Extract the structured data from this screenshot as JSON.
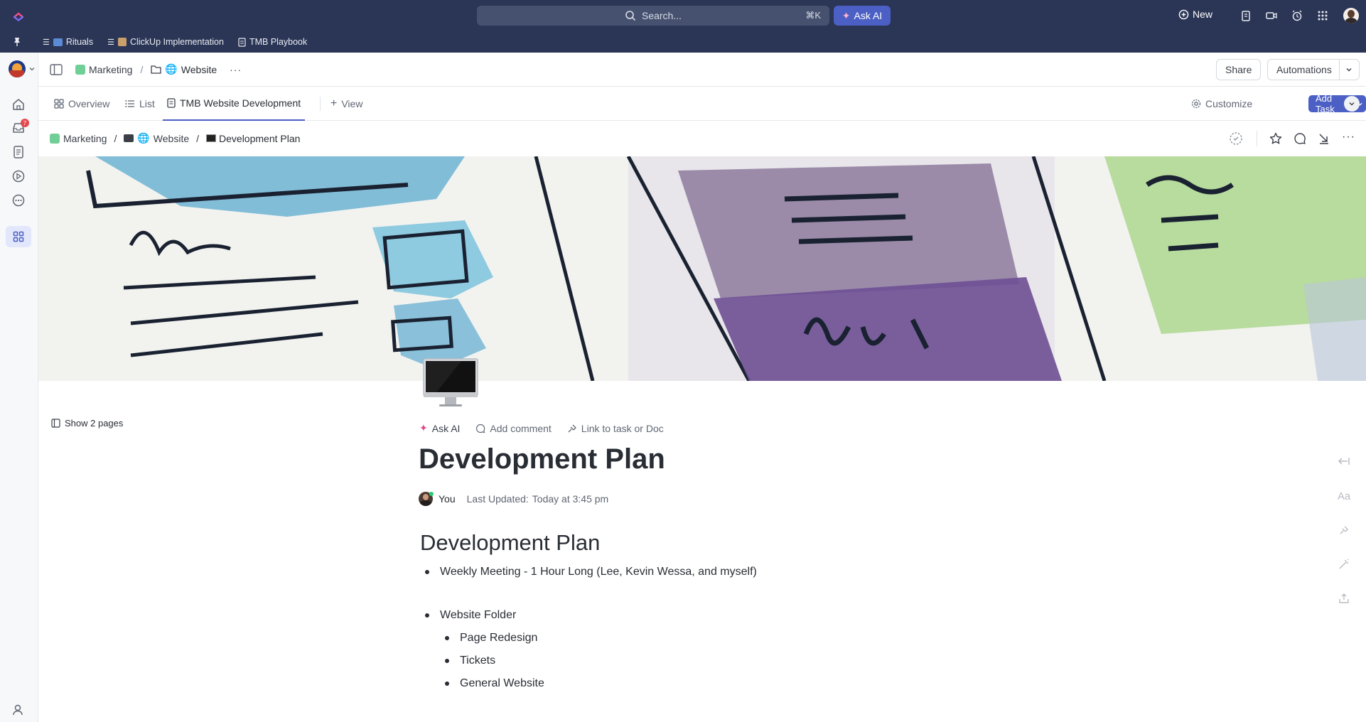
{
  "topbar": {
    "search_placeholder": "Search...",
    "search_shortcut": "⌘K",
    "ask_ai": "Ask AI",
    "new_label": "New",
    "icons": [
      "notepad-icon",
      "video-icon",
      "alarm-icon",
      "apps-grid-icon",
      "user-avatar"
    ]
  },
  "bookmarks": [
    {
      "label": "Rituals"
    },
    {
      "label": "ClickUp Implementation"
    },
    {
      "label": "TMB Playbook"
    }
  ],
  "sidebar": {
    "notification_count": "7"
  },
  "header": {
    "space": "Marketing",
    "folder": "Website",
    "share": "Share",
    "automations": "Automations"
  },
  "tabs": [
    {
      "label": "Overview"
    },
    {
      "label": "List"
    },
    {
      "label": "TMB Website Development"
    },
    {
      "label": "View"
    }
  ],
  "toolbar": {
    "customize": "Customize",
    "add_task": "Add Task"
  },
  "breadcrumb": {
    "space": "Marketing",
    "folder": "Website",
    "page": "Development Plan"
  },
  "doc": {
    "show_pages": "Show 2 pages",
    "ask_ai": "Ask AI",
    "add_comment": "Add comment",
    "link_label": "Link to task or Doc",
    "title": "Development Plan",
    "author": "You",
    "last_updated_label": "Last Updated:",
    "last_updated_value": "Today at 3:45 pm",
    "heading": "Development Plan",
    "items": [
      "Weekly Meeting - 1 Hour Long (Lee, Kevin Wessa, and myself)",
      "Website Folder",
      "Page Redesign",
      "Tickets",
      "General Website"
    ]
  },
  "right_tools": {
    "font_label": "Aa"
  },
  "colors": {
    "topbar": "#2b3656",
    "accent": "#4b5fc4",
    "notification": "#e5484d"
  }
}
